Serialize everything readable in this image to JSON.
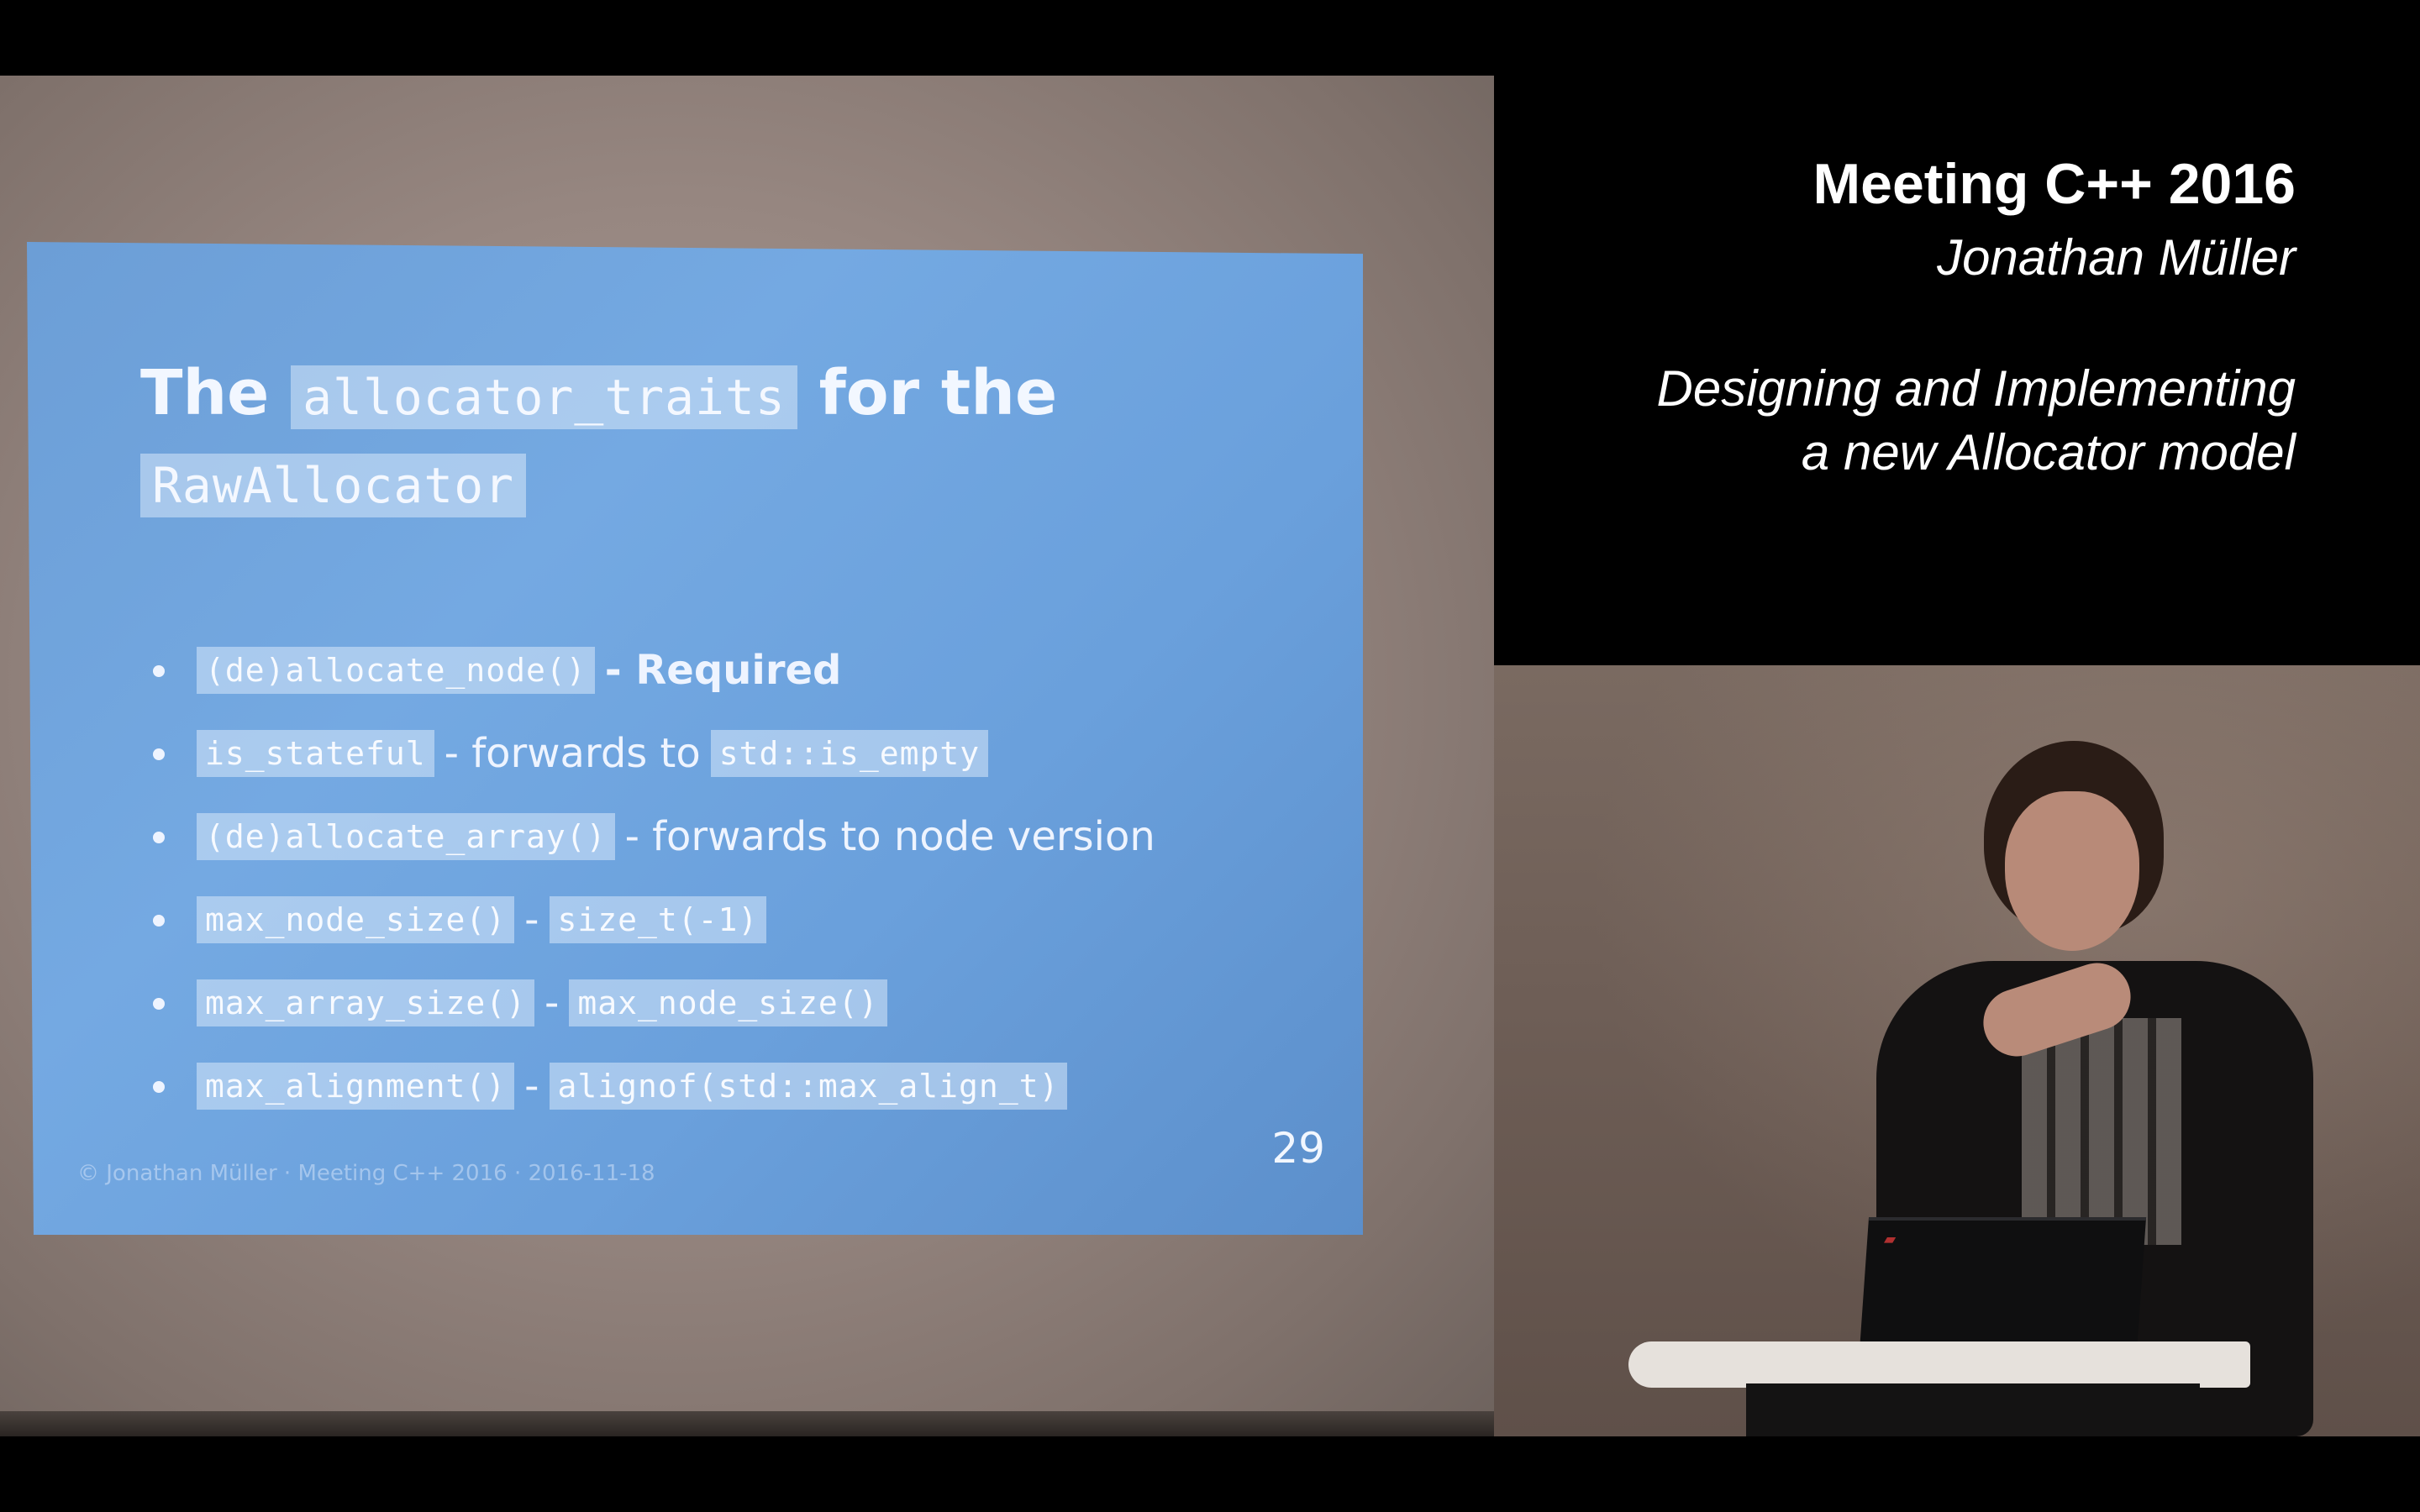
{
  "title_card": {
    "event": "Meeting C++ 2016",
    "speaker": "Jonathan Müller",
    "talk_line1": "Designing and Implementing",
    "talk_line2": "a new Allocator model"
  },
  "slide": {
    "title": {
      "line1_prefix": "The",
      "line1_code": "allocator_traits",
      "line1_suffix": "for the",
      "line2_code": "RawAllocator"
    },
    "bullets": [
      {
        "code": "(de)allocate_node()",
        "separator": "- Required"
      },
      {
        "code": "is_stateful",
        "separator": "- forwards to",
        "code2": "std::is_empty"
      },
      {
        "code": "(de)allocate_array()",
        "separator": "- forwards to node version"
      },
      {
        "code": "max_node_size()",
        "separator": "-",
        "code2": "size_t(-1)"
      },
      {
        "code": "max_array_size()",
        "separator": "-",
        "code2": "max_node_size()"
      },
      {
        "code": "max_alignment()",
        "separator": "-",
        "code2": "alignof(std::max_align_t)"
      }
    ],
    "footer": "© Jonathan Müller · Meeting C++ 2016 · 2016-11-18",
    "page_number": "29"
  },
  "colors": {
    "slide_background": "#6ca3de",
    "title_card_background": "#000000",
    "title_card_text": "#ffffff"
  }
}
